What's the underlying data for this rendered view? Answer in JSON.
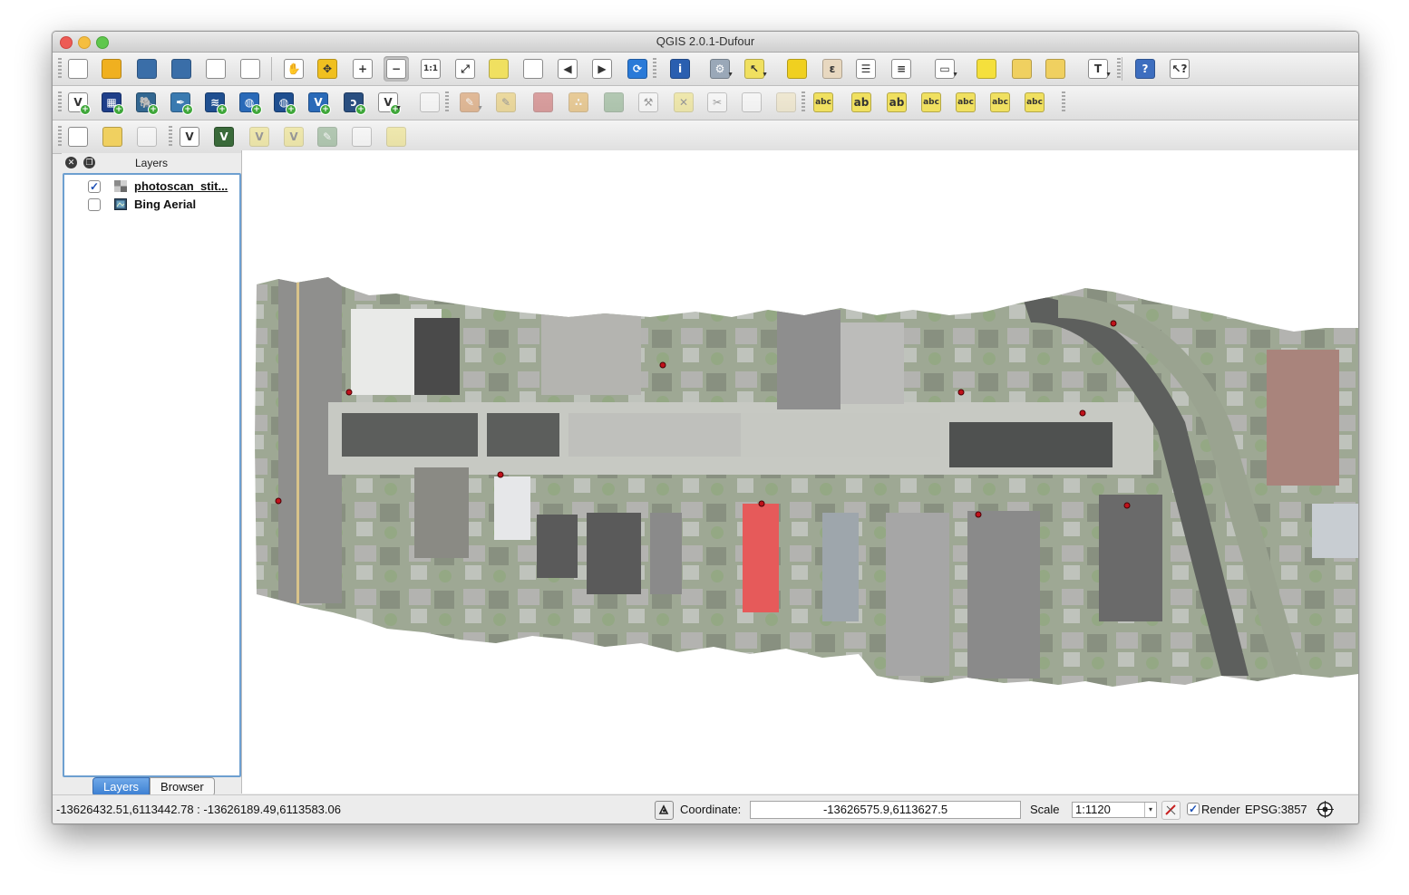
{
  "window": {
    "title": "QGIS 2.0.1-Dufour"
  },
  "toolbars": {
    "file_nav": [
      {
        "name": "new-project-icon",
        "glyph": "",
        "color": "#ffffff"
      },
      {
        "name": "open-project-icon",
        "glyph": "",
        "color": "#f0b020"
      },
      {
        "name": "save-project-icon",
        "glyph": "",
        "color": "#3a6ea8"
      },
      {
        "name": "save-as-icon",
        "glyph": "",
        "color": "#3a6ea8"
      },
      {
        "name": "new-print-composer-icon",
        "glyph": "",
        "color": "#ffffff"
      },
      {
        "name": "composer-manager-icon",
        "glyph": "",
        "color": "#ffffff"
      },
      {
        "name": "pan-icon",
        "glyph": "✋",
        "color": "#ffffff"
      },
      {
        "name": "pan-to-selection-icon",
        "glyph": "✥",
        "color": "#f0c020"
      },
      {
        "name": "zoom-in-icon",
        "glyph": "+",
        "color": "#ffffff"
      },
      {
        "name": "zoom-out-icon",
        "glyph": "−",
        "color": "#ffffff"
      },
      {
        "name": "zoom-actual-size-icon",
        "glyph": "1:1",
        "color": "#ffffff"
      },
      {
        "name": "zoom-full-icon",
        "glyph": "⤢",
        "color": "#ffffff"
      },
      {
        "name": "zoom-to-selection-icon",
        "glyph": "",
        "color": "#f0e060"
      },
      {
        "name": "zoom-to-layer-icon",
        "glyph": "",
        "color": "#ffffff"
      },
      {
        "name": "zoom-last-icon",
        "glyph": "◀",
        "color": "#ffffff"
      },
      {
        "name": "zoom-next-icon",
        "glyph": "▶",
        "color": "#ffffff"
      },
      {
        "name": "refresh-icon",
        "glyph": "⟳",
        "color": "#2a7ad8"
      },
      {
        "name": "identify-icon",
        "glyph": "i",
        "color": "#2a5fb0"
      },
      {
        "name": "run-action-icon",
        "glyph": "⚙",
        "color": "#9aa8b8"
      },
      {
        "name": "select-features-icon",
        "glyph": "↖",
        "color": "#f0e060"
      },
      {
        "name": "deselect-all-icon",
        "glyph": "",
        "color": "#f0d020"
      },
      {
        "name": "field-calculator-icon",
        "glyph": "ε",
        "color": "#e8d8c0"
      },
      {
        "name": "attribute-table-icon",
        "glyph": "☰",
        "color": "#ffffff"
      },
      {
        "name": "statistics-icon",
        "glyph": "≡",
        "color": "#ffffff"
      },
      {
        "name": "measure-icon",
        "glyph": "▭",
        "color": "#ffffff"
      },
      {
        "name": "map-tips-icon",
        "glyph": "",
        "color": "#f5e03c"
      },
      {
        "name": "new-bookmark-icon",
        "glyph": "",
        "color": "#f0d060"
      },
      {
        "name": "show-bookmarks-icon",
        "glyph": "",
        "color": "#f0d060"
      },
      {
        "name": "text-annotation-icon",
        "glyph": "T",
        "color": "#ffffff"
      },
      {
        "name": "help-icon",
        "glyph": "?",
        "color": "#3d6ebf"
      },
      {
        "name": "whats-this-icon",
        "glyph": "↖?",
        "color": "#ffffff"
      }
    ],
    "layers": [
      {
        "name": "add-vector-layer-icon",
        "glyph": "V",
        "color": "#ffffff"
      },
      {
        "name": "add-raster-layer-icon",
        "glyph": "▦",
        "color": "#1f3f8a"
      },
      {
        "name": "add-postgis-layer-icon",
        "glyph": "🐘",
        "color": "#336791"
      },
      {
        "name": "add-spatialite-layer-icon",
        "glyph": "✒",
        "color": "#3a7ab0"
      },
      {
        "name": "add-mssql-layer-icon",
        "glyph": "≋",
        "color": "#1f4f90"
      },
      {
        "name": "add-wms-layer-icon",
        "glyph": "◍",
        "color": "#2a6ab8"
      },
      {
        "name": "add-wcs-layer-icon",
        "glyph": "◍",
        "color": "#1f4f90"
      },
      {
        "name": "add-wfs-layer-icon",
        "glyph": "V",
        "color": "#2a6ab8"
      },
      {
        "name": "add-delimited-text-icon",
        "glyph": "ɔ",
        "color": "#2a4f80"
      },
      {
        "name": "new-shapefile-icon",
        "glyph": "V",
        "color": "#ffffff"
      },
      {
        "name": "remove-layer-icon",
        "glyph": "",
        "color": "#ffffff"
      },
      {
        "name": "toggle-editing-icon",
        "glyph": "✎",
        "color": "#d07a30"
      },
      {
        "name": "pencil-icon",
        "glyph": "✎",
        "color": "#e8c040"
      },
      {
        "name": "save-edits-icon",
        "glyph": "",
        "color": "#c04040"
      },
      {
        "name": "add-feature-icon",
        "glyph": "∴",
        "color": "#e0a030"
      },
      {
        "name": "move-feature-icon",
        "glyph": "",
        "color": "#6a9a6a"
      },
      {
        "name": "node-tool-icon",
        "glyph": "⚒",
        "color": "#ffffff"
      },
      {
        "name": "delete-selected-icon",
        "glyph": "✕",
        "color": "#f0e060"
      },
      {
        "name": "cut-features-icon",
        "glyph": "✂",
        "color": "#ffffff"
      },
      {
        "name": "copy-features-icon",
        "glyph": "",
        "color": "#ffffff"
      },
      {
        "name": "paste-features-icon",
        "glyph": "",
        "color": "#f0e0b0"
      },
      {
        "name": "label-tool-icon",
        "glyph": "abc",
        "color": "#f0e060"
      },
      {
        "name": "highlight-pinned-labels-icon",
        "glyph": "ab",
        "color": "#f0e060"
      },
      {
        "name": "pin-labels-icon",
        "glyph": "ab",
        "color": "#f0e060"
      },
      {
        "name": "show-hide-labels-icon",
        "glyph": "abc",
        "color": "#f0e060"
      },
      {
        "name": "move-label-icon",
        "glyph": "abc",
        "color": "#f0e060"
      },
      {
        "name": "rotate-label-icon",
        "glyph": "abc",
        "color": "#f0e060"
      },
      {
        "name": "change-label-icon",
        "glyph": "abc",
        "color": "#f0e060"
      }
    ],
    "digitize": [
      {
        "name": "show-layers-icon",
        "glyph": "",
        "color": "#ffffff"
      },
      {
        "name": "hide-layers-icon",
        "glyph": "",
        "color": "#f0d060"
      },
      {
        "name": "remove-layers-icon",
        "glyph": "",
        "color": "#ffffff"
      },
      {
        "name": "add-ring-icon",
        "glyph": "V",
        "color": "#ffffff"
      },
      {
        "name": "add-part-icon",
        "glyph": "V",
        "color": "#3a6a3a"
      },
      {
        "name": "fill-ring-icon",
        "glyph": "V",
        "color": "#f0e060"
      },
      {
        "name": "delete-ring-icon",
        "glyph": "V",
        "color": "#f0e060"
      },
      {
        "name": "delete-part-icon",
        "glyph": "✎",
        "color": "#6a9a6a"
      },
      {
        "name": "reshape-features-icon",
        "glyph": "",
        "color": "#ffffff"
      },
      {
        "name": "split-features-icon",
        "glyph": "",
        "color": "#f0e060"
      }
    ]
  },
  "layers_panel": {
    "title": "Layers",
    "items": [
      {
        "label": "photoscan_stit...",
        "checked": true,
        "icon": "raster-layer-icon"
      },
      {
        "label": "Bing Aerial",
        "checked": false,
        "icon": "wms-layer-icon"
      }
    ],
    "tabs": [
      {
        "label": "Layers"
      },
      {
        "label": "Browser"
      }
    ]
  },
  "canvas": {
    "background": "#ffffff"
  },
  "status": {
    "extents": "-13626432.51,6113442.78 : -13626189.49,6113583.06",
    "coordinate_label": "Coordinate:",
    "coordinate_value": "-13626575.9,6113627.5",
    "scale_label": "Scale",
    "scale_value": "1:1120",
    "render_label": "Render",
    "render_checked": true,
    "crs": "EPSG:3857"
  }
}
